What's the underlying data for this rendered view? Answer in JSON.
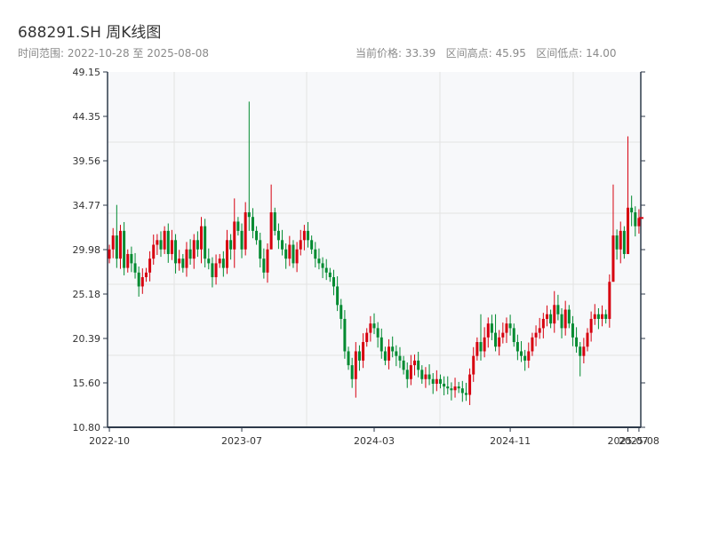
{
  "header": {
    "title": "688291.SH 周K线图",
    "range": "时间范围: 2022-10-28 至 2025-08-08",
    "stats": "当前价格: 33.39   区间高点: 45.95   区间低点: 14.00"
  },
  "chart_data": {
    "type": "candlestick",
    "title": "688291.SH 周K线图",
    "ylim": [
      10.8,
      49.15
    ],
    "yticks": [
      "10.80",
      "15.60",
      "20.39",
      "25.18",
      "29.98",
      "34.77",
      "39.56",
      "44.35",
      "49.15"
    ],
    "xticks": [
      {
        "label": "2022-10",
        "week": 0
      },
      {
        "label": "2023-07",
        "week": 36
      },
      {
        "label": "2024-03",
        "week": 72
      },
      {
        "label": "2024-11",
        "week": 109
      },
      {
        "label": "2025-07",
        "week": 141
      },
      {
        "label": "2025-08",
        "week": 144
      }
    ],
    "colors": {
      "up": "#d7000f",
      "down": "#008a30"
    },
    "first_open": 29,
    "closes": [
      30,
      31.5,
      29,
      32,
      28,
      29.5,
      28.5,
      27.5,
      26,
      27,
      27.5,
      29,
      30.5,
      31,
      30,
      32,
      29.5,
      31,
      28.5,
      29,
      28,
      30,
      29,
      31,
      30,
      32.5,
      29,
      28.5,
      27,
      28.5,
      29,
      28,
      31,
      30,
      33,
      32,
      30,
      34,
      33.5,
      32,
      31,
      29,
      27.5,
      30,
      34,
      32,
      31,
      30,
      29,
      30.5,
      28.5,
      30,
      31,
      32,
      31,
      30,
      29,
      28.5,
      28,
      27.5,
      27,
      26,
      24,
      22.5,
      19,
      17.5,
      16,
      19,
      18,
      20,
      21,
      22,
      21.5,
      20.5,
      19,
      18,
      19.5,
      19,
      18.5,
      18,
      17,
      16,
      17.5,
      18,
      17,
      16,
      16.5,
      16,
      15.5,
      16,
      15.5,
      15.2,
      15,
      14.8,
      15.2,
      15,
      14.5,
      14.3,
      16.5,
      18.5,
      20,
      19,
      20.5,
      22,
      21,
      19.5,
      20.5,
      21,
      22,
      21.5,
      20,
      19,
      18.5,
      18,
      19,
      20.5,
      21,
      21.5,
      22.5,
      23,
      22,
      24,
      23,
      21.5,
      23.5,
      22,
      20.5,
      19.5,
      18.5,
      19.5,
      21,
      22.5,
      23,
      22.5,
      23,
      22.5,
      26.5,
      31.5,
      30,
      32,
      29.5,
      34.5,
      34,
      32.5,
      33.39
    ],
    "wick_extremes": {
      "2": [
        34.8,
        28
      ],
      "25": [
        33.5,
        28.5
      ],
      "34": [
        35.5,
        28
      ],
      "38": [
        45.95,
        32
      ],
      "44": [
        37,
        31
      ],
      "67": [
        20,
        14.0
      ],
      "101": [
        23,
        18
      ],
      "105": [
        23,
        19
      ],
      "121": [
        25.5,
        21
      ],
      "128": [
        20,
        16.3
      ],
      "137": [
        37,
        30
      ],
      "139": [
        33,
        28.5
      ],
      "141": [
        42.2,
        33.5
      ],
      "142": [
        35.8,
        32.5
      ]
    }
  }
}
